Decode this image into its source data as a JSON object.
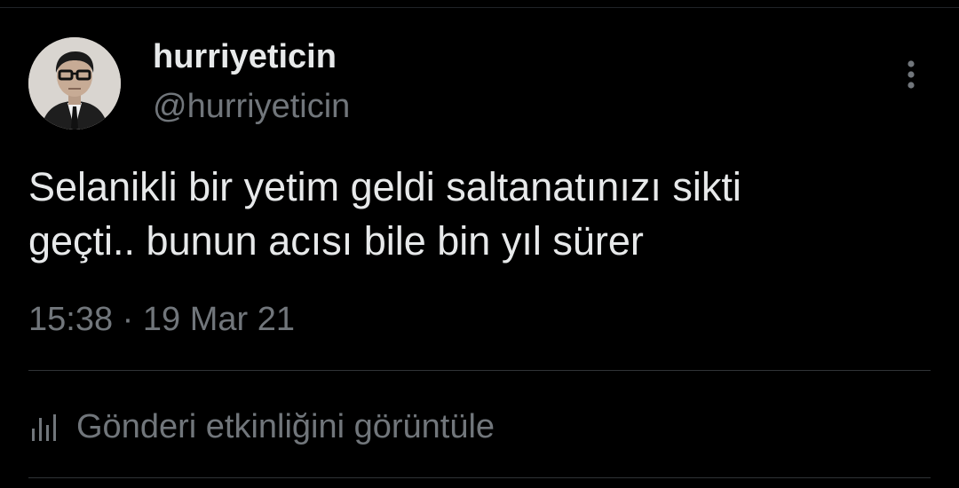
{
  "tweet": {
    "author": {
      "display_name": "hurriyeticin",
      "handle": "@hurriyeticin",
      "avatar_icon": "portrait-photo"
    },
    "text": "Selanikli bir yetim geldi saltanatınızı sikti\ngeçti.. bunun acısı bile bin yıl sürer",
    "time": "15:38",
    "separator": "·",
    "date": "19 Mar 21",
    "more_icon": "more-vertical-icon"
  },
  "activity": {
    "icon": "bar-chart-icon",
    "label": "Gönderi etkinliğini görüntüle"
  },
  "colors": {
    "background": "#000000",
    "primary_text": "#e7e9ea",
    "secondary_text": "#71767b",
    "divider": "#2f3336"
  }
}
